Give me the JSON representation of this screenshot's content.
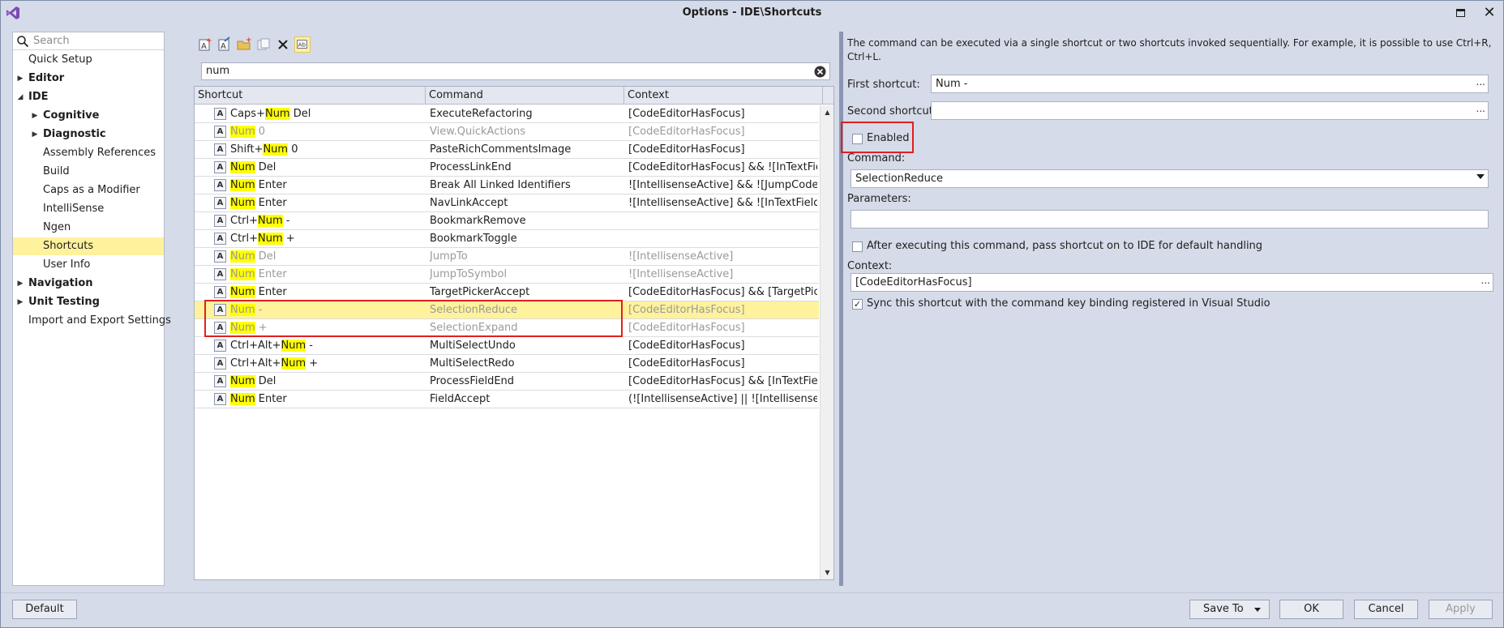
{
  "window": {
    "title": "Options - IDE\\Shortcuts"
  },
  "sidebar": {
    "search_placeholder": "Search",
    "items": [
      {
        "label": "Quick Setup",
        "bold": false,
        "arrow": "",
        "indent": 0
      },
      {
        "label": "Editor",
        "bold": true,
        "arrow": "right",
        "indent": 0
      },
      {
        "label": "IDE",
        "bold": true,
        "arrow": "down",
        "indent": 0
      },
      {
        "label": "Cognitive",
        "bold": true,
        "arrow": "right",
        "indent": 1
      },
      {
        "label": "Diagnostic",
        "bold": true,
        "arrow": "right",
        "indent": 1
      },
      {
        "label": "Assembly References",
        "bold": false,
        "arrow": "",
        "indent": 1
      },
      {
        "label": "Build",
        "bold": false,
        "arrow": "",
        "indent": 1
      },
      {
        "label": "Caps as a Modifier",
        "bold": false,
        "arrow": "",
        "indent": 1
      },
      {
        "label": "IntelliSense",
        "bold": false,
        "arrow": "",
        "indent": 1
      },
      {
        "label": "Ngen",
        "bold": false,
        "arrow": "",
        "indent": 1
      },
      {
        "label": "Shortcuts",
        "bold": false,
        "arrow": "",
        "indent": 1,
        "selected": true
      },
      {
        "label": "User Info",
        "bold": false,
        "arrow": "",
        "indent": 1
      },
      {
        "label": "Navigation",
        "bold": true,
        "arrow": "right",
        "indent": 0
      },
      {
        "label": "Unit Testing",
        "bold": true,
        "arrow": "right",
        "indent": 0
      },
      {
        "label": "Import and Export Settings",
        "bold": false,
        "arrow": "",
        "indent": 0
      }
    ]
  },
  "toolbar": {
    "icons": [
      "add-shortcut-icon",
      "add-folder-icon",
      "open-folder-icon",
      "copy-icon",
      "delete-icon",
      "match-case-icon"
    ]
  },
  "filter": {
    "value": "num"
  },
  "grid": {
    "columns": [
      "Shortcut",
      "Command",
      "Context"
    ],
    "rows": [
      {
        "pre": "Caps+",
        "hl": "Num",
        "post": " Del",
        "command": "ExecuteRefactoring",
        "context": "[CodeEditorHasFocus]",
        "dim": false,
        "selected": false
      },
      {
        "pre": "",
        "hl": "Num",
        "post": " 0",
        "command": "View.QuickActions",
        "context": "[CodeEditorHasFocus]",
        "dim": true,
        "selected": false
      },
      {
        "pre": "Shift+",
        "hl": "Num",
        "post": " 0",
        "command": "PasteRichCommentsImage",
        "context": "[CodeEditorHasFocus]",
        "dim": false,
        "selected": false
      },
      {
        "pre": "",
        "hl": "Num",
        "post": " Del",
        "command": "ProcessLinkEnd",
        "context": "[CodeEditorHasFocus] && ![InTextField...",
        "dim": false,
        "selected": false
      },
      {
        "pre": "",
        "hl": "Num",
        "post": " Enter",
        "command": "Break All Linked Identifiers",
        "context": "![IntellisenseActive] && ![JumpCodesIs...",
        "dim": false,
        "selected": false
      },
      {
        "pre": "",
        "hl": "Num",
        "post": " Enter",
        "command": "NavLinkAccept",
        "context": "![IntellisenseActive] && ![InTextField] &...",
        "dim": false,
        "selected": false
      },
      {
        "pre": "Ctrl+",
        "hl": "Num",
        "post": " -",
        "command": "BookmarkRemove",
        "context": "",
        "dim": false,
        "selected": false
      },
      {
        "pre": "Ctrl+",
        "hl": "Num",
        "post": " +",
        "command": "BookmarkToggle",
        "context": "",
        "dim": false,
        "selected": false
      },
      {
        "pre": "",
        "hl": "Num",
        "post": " Del",
        "command": "JumpTo",
        "context": "![IntellisenseActive]",
        "dim": true,
        "selected": false
      },
      {
        "pre": "",
        "hl": "Num",
        "post": " Enter",
        "command": "JumpToSymbol",
        "context": "![IntellisenseActive]",
        "dim": true,
        "selected": false
      },
      {
        "pre": "",
        "hl": "Num",
        "post": " Enter",
        "command": "TargetPickerAccept",
        "context": "[CodeEditorHasFocus] && [TargetPick...",
        "dim": false,
        "selected": false
      },
      {
        "pre": "",
        "hl": "Num",
        "post": " -",
        "command": "SelectionReduce",
        "context": "[CodeEditorHasFocus]",
        "dim": true,
        "selected": true
      },
      {
        "pre": "",
        "hl": "Num",
        "post": " +",
        "command": "SelectionExpand",
        "context": "[CodeEditorHasFocus]",
        "dim": true,
        "selected": false
      },
      {
        "pre": "Ctrl+Alt+",
        "hl": "Num",
        "post": " -",
        "command": "MultiSelectUndo",
        "context": "[CodeEditorHasFocus]",
        "dim": false,
        "selected": false
      },
      {
        "pre": "Ctrl+Alt+",
        "hl": "Num",
        "post": " +",
        "command": "MultiSelectRedo",
        "context": "[CodeEditorHasFocus]",
        "dim": false,
        "selected": false
      },
      {
        "pre": "",
        "hl": "Num",
        "post": " Del",
        "command": "ProcessFieldEnd",
        "context": "[CodeEditorHasFocus] && [InTextField]",
        "dim": false,
        "selected": false
      },
      {
        "pre": "",
        "hl": "Num",
        "post": " Enter",
        "command": "FieldAccept",
        "context": "(![IntellisenseActive] || ![IntellisenseHas...",
        "dim": false,
        "selected": false
      }
    ],
    "row_icon_letter": "A"
  },
  "details": {
    "description": "The command can be executed via a single shortcut or two shortcuts invoked sequentially. For example, it is possible to use Ctrl+R, Ctrl+L.",
    "first_shortcut_label": "First shortcut:",
    "first_shortcut_value": "Num -",
    "second_shortcut_label": "Second shortcut:",
    "second_shortcut_value": "",
    "enabled_label": "Enabled",
    "enabled_checked": false,
    "command_label": "Command:",
    "command_value": "SelectionReduce",
    "parameters_label": "Parameters:",
    "parameters_value": "",
    "pass_shortcut_label": "After executing this command, pass shortcut on to IDE for default handling",
    "pass_shortcut_checked": false,
    "context_label": "Context:",
    "context_value": "[CodeEditorHasFocus]",
    "sync_label": "Sync this shortcut with the command key binding registered in Visual Studio",
    "sync_checked": true,
    "ellipsis": "..."
  },
  "buttons": {
    "default": "Default",
    "save_to": "Save To",
    "ok": "OK",
    "cancel": "Cancel",
    "apply": "Apply"
  },
  "colors": {
    "highlight": "#ffff00",
    "selected_row": "#fff29d",
    "annotation_red": "#e02020"
  }
}
